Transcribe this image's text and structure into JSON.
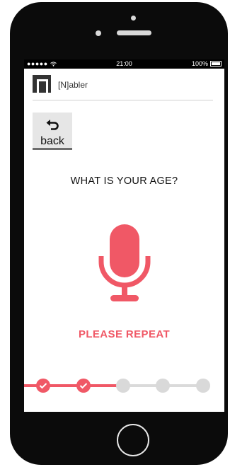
{
  "status_bar": {
    "signal": "●●●●● ",
    "time": "21:00",
    "battery": "100%"
  },
  "app": {
    "title": "[N]abler"
  },
  "back_button": {
    "label": "back"
  },
  "question": {
    "text": "WHAT IS YOUR AGE?"
  },
  "feedback": {
    "text": "PLEASE REPEAT"
  },
  "progress": {
    "steps_total": 5,
    "steps_done": 2
  },
  "colors": {
    "accent": "#f05866",
    "inactive": "#d9d9d9",
    "frame": "#0b0b0b"
  }
}
